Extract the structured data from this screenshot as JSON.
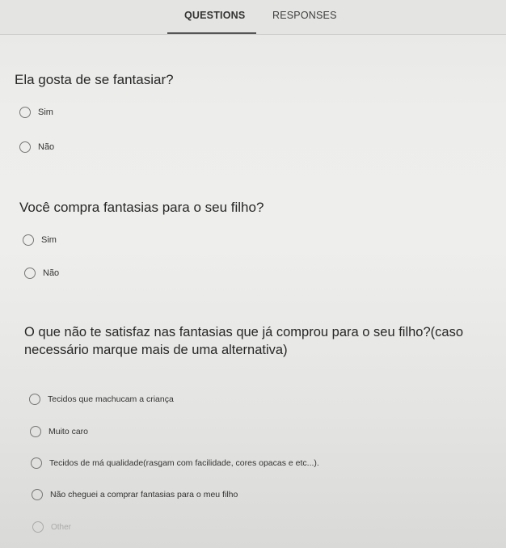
{
  "tabs": {
    "questions": "QUESTIONS",
    "responses": "RESPONSES"
  },
  "q1": {
    "text": "Ela gosta de se fantasiar?",
    "options": [
      "Sim",
      "Não"
    ]
  },
  "q2": {
    "text": "Você compra fantasias para o seu filho?",
    "options": [
      "Sim",
      "Não"
    ]
  },
  "q3": {
    "line1": "O que não te satisfaz nas fantasias que já comprou para o seu filho?(caso",
    "line2": "necessário marque mais de uma alternativa)",
    "options": [
      "Tecidos que machucam a criança",
      "Muito caro",
      "Tecidos de má qualidade(rasgam com facilidade, cores opacas e etc...).",
      "Não cheguei a comprar fantasias  para o meu filho",
      "Other"
    ]
  }
}
